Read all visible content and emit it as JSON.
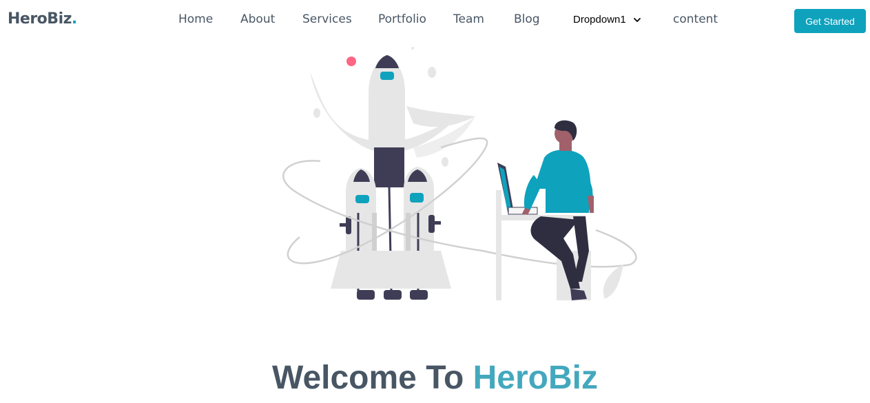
{
  "brand": {
    "name": "HeroBiz",
    "dot": "."
  },
  "nav": {
    "items": [
      {
        "label": "Home"
      },
      {
        "label": "About"
      },
      {
        "label": "Services"
      },
      {
        "label": "Portfolio"
      },
      {
        "label": "Team"
      },
      {
        "label": "Blog"
      }
    ],
    "dropdown": {
      "label": "Dropdown1",
      "icon": "chevron-down-icon"
    },
    "extra": {
      "label": "content"
    }
  },
  "cta": {
    "label": "Get Started"
  },
  "hero": {
    "title_prefix": "Welcome To",
    "title_brand": "HeroBiz"
  },
  "colors": {
    "accent": "#0ea2bd",
    "text": "#485664",
    "brand_title": "#44a8bd",
    "illustration_dark": "#3f3d56",
    "illustration_light": "#e6e6e6",
    "illustration_accent": "#0ea2bd",
    "illustration_pink": "#ff6584"
  }
}
